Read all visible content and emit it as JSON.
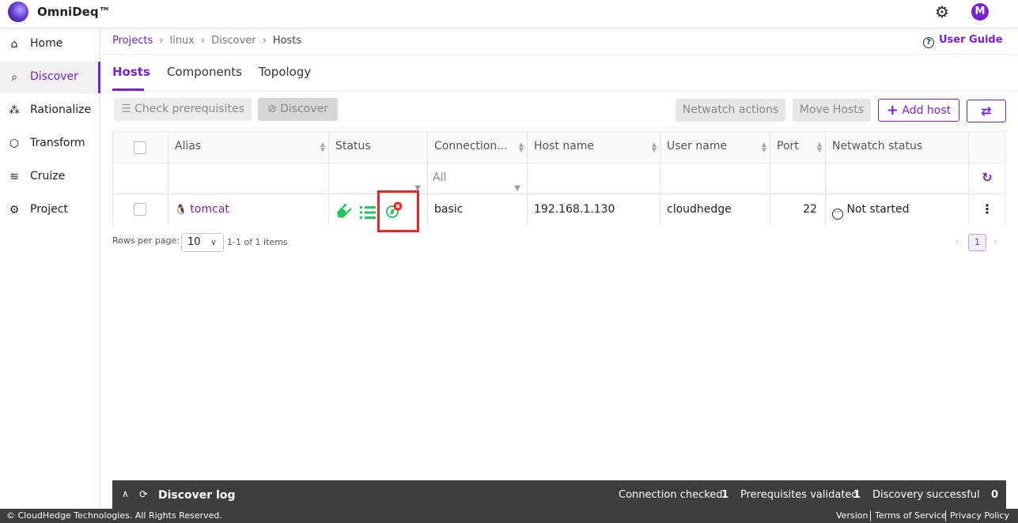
{
  "app": {
    "brand": "OmniDeq™",
    "avatar_letter": "M"
  },
  "sidebar": {
    "items": [
      {
        "label": "Home",
        "icon": "home-icon"
      },
      {
        "label": "Discover",
        "icon": "discover-icon"
      },
      {
        "label": "Rationalize",
        "icon": "rationalize-icon"
      },
      {
        "label": "Transform",
        "icon": "cube-icon"
      },
      {
        "label": "Cruize",
        "icon": "cruize-icon"
      },
      {
        "label": "Project",
        "icon": "gear-icon"
      }
    ]
  },
  "breadcrumb": [
    "Projects",
    "linux",
    "Discover",
    "Hosts"
  ],
  "user_guide": "User Guide",
  "tabs": [
    "Hosts",
    "Components",
    "Topology"
  ],
  "toolbar": {
    "check_prereq": "Check prerequisites",
    "discover": "Discover",
    "netwatch": "Netwatch actions",
    "move_hosts": "Move Hosts",
    "add_host": "Add host"
  },
  "table": {
    "headers": [
      "Alias",
      "Status",
      "Connection...",
      "Host name",
      "User name",
      "Port",
      "Netwatch status"
    ],
    "filter_connection": "All",
    "rows": [
      {
        "alias": "tomcat",
        "connection": "basic",
        "host": "192.168.1.130",
        "user": "cloudhedge",
        "port": "22",
        "netwatch": "Not started"
      }
    ]
  },
  "pagination": {
    "label": "Rows per page:",
    "rows_per_page": "10",
    "range": "1-1 of 1 items",
    "page": "1"
  },
  "log": {
    "title": "Discover log",
    "stats": [
      {
        "label": "Connection checked",
        "value": "1"
      },
      {
        "label": "Prerequisites validated",
        "value": "1"
      },
      {
        "label": "Discovery successful",
        "value": "0"
      }
    ]
  },
  "footer": {
    "copyright": "© CloudHedge Technologies. All Rights Reserved.",
    "links": [
      "Version",
      "Terms of Service",
      "Privacy Policy"
    ]
  },
  "colors": {
    "accent": "#7a1fd6",
    "success": "#22c55e",
    "error": "#e8261e"
  }
}
